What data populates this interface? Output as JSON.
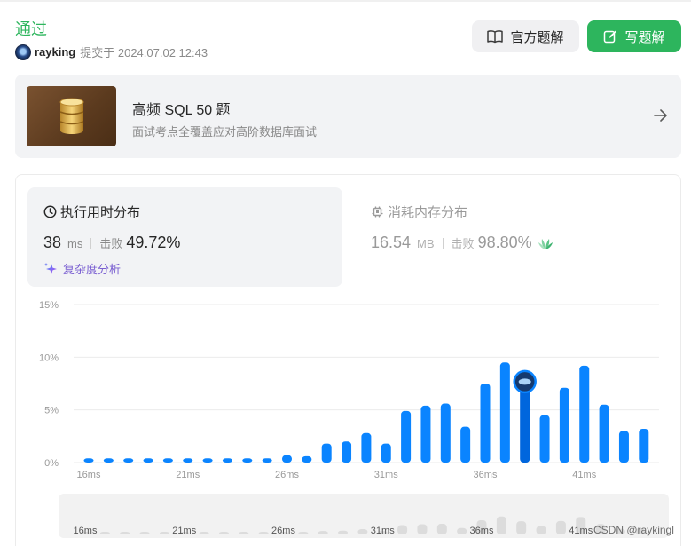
{
  "header": {
    "status": "通过",
    "username": "rayking",
    "submitted_text": "提交于 2024.07.02 12:43",
    "official_solution_label": "官方题解",
    "write_solution_label": "写题解"
  },
  "study_plan": {
    "title": "高频 SQL 50 题",
    "subtitle": "面试考点全覆盖应对高阶数据库面试"
  },
  "runtime": {
    "title": "执行用时分布",
    "value": "38",
    "unit": "ms",
    "beats_label": "击败",
    "beats_pct": "49.72%",
    "complexity_label": "复杂度分析"
  },
  "memory": {
    "title": "消耗内存分布",
    "value": "16.54",
    "unit": "MB",
    "beats_label": "击败",
    "beats_pct": "98.80%"
  },
  "colors": {
    "accent_green": "#2db55d",
    "bar_blue": "#0a84ff",
    "bar_highlight": "#0066dd",
    "complexity_purple": "#7a5fd1"
  },
  "chart_data": {
    "type": "bar",
    "x": [
      16,
      17,
      18,
      19,
      20,
      21,
      22,
      23,
      24,
      25,
      26,
      27,
      28,
      29,
      30,
      31,
      32,
      33,
      34,
      35,
      36,
      37,
      38,
      39,
      40,
      41,
      42,
      43,
      44
    ],
    "values": [
      0.4,
      0.4,
      0.4,
      0.4,
      0.4,
      0.4,
      0.4,
      0.4,
      0.4,
      0.4,
      0.7,
      0.6,
      1.8,
      2.0,
      2.8,
      1.8,
      4.9,
      5.4,
      5.6,
      3.4,
      7.5,
      9.5,
      7.0,
      4.5,
      7.1,
      9.2,
      5.5,
      3.0,
      3.2
    ],
    "current_x": 38,
    "ylim": [
      0,
      15
    ],
    "yticks": [
      "0%",
      "5%",
      "10%",
      "15%"
    ],
    "ytick_values": [
      0,
      5,
      10,
      15
    ],
    "xticks": [
      "16ms",
      "21ms",
      "26ms",
      "31ms",
      "36ms",
      "41ms"
    ],
    "xtick_values": [
      16,
      21,
      26,
      31,
      36,
      41
    ],
    "grid": true
  },
  "watermark": "CSDN @raykingl"
}
